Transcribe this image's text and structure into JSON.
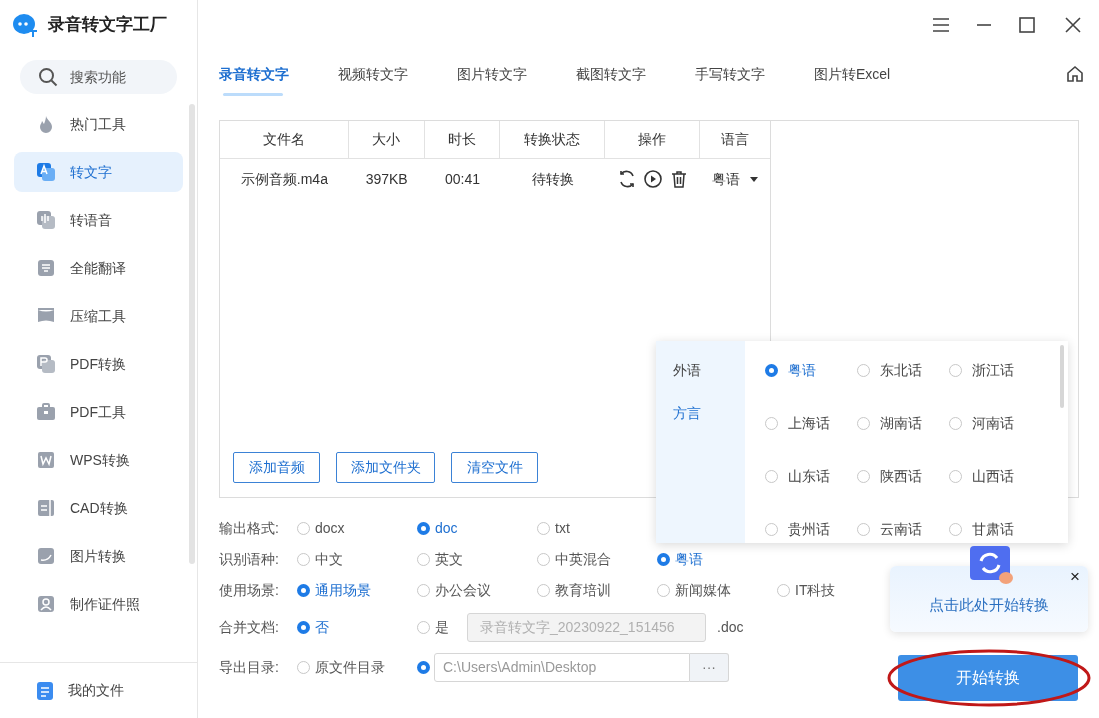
{
  "app": {
    "title": "录音转文字工厂"
  },
  "search": {
    "placeholder": "搜索功能"
  },
  "sidebar": {
    "items": [
      {
        "label": "热门工具",
        "selected": false
      },
      {
        "label": "转文字",
        "selected": true
      },
      {
        "label": "转语音",
        "selected": false
      },
      {
        "label": "全能翻译",
        "selected": false
      },
      {
        "label": "压缩工具",
        "selected": false
      },
      {
        "label": "PDF转换",
        "selected": false
      },
      {
        "label": "PDF工具",
        "selected": false
      },
      {
        "label": "WPS转换",
        "selected": false
      },
      {
        "label": "CAD转换",
        "selected": false
      },
      {
        "label": "图片转换",
        "selected": false
      },
      {
        "label": "制作证件照",
        "selected": false
      }
    ],
    "footer": "我的文件"
  },
  "tabs": [
    {
      "label": "录音转文字",
      "selected": true
    },
    {
      "label": "视频转文字",
      "selected": false
    },
    {
      "label": "图片转文字",
      "selected": false
    },
    {
      "label": "截图转文字",
      "selected": false
    },
    {
      "label": "手写转文字",
      "selected": false
    },
    {
      "label": "图片转Excel",
      "selected": false
    }
  ],
  "table": {
    "columns": [
      "文件名",
      "大小",
      "时长",
      "转换状态",
      "操作",
      "语言"
    ],
    "rows": [
      {
        "cells": [
          "示例音频.m4a",
          "397KB",
          "00:41",
          "待转换"
        ],
        "language": "粤语"
      }
    ]
  },
  "buttons": [
    "添加音频",
    "添加文件夹",
    "清空文件"
  ],
  "options": [
    {
      "kind": "radio",
      "label": "输出格式:",
      "choices": [
        {
          "label": "docx",
          "selected": false
        },
        {
          "label": "doc",
          "selected": true
        },
        {
          "label": "txt",
          "selected": false
        }
      ]
    },
    {
      "kind": "radio",
      "label": "识别语种:",
      "choices": [
        {
          "label": "中文",
          "selected": false
        },
        {
          "label": "英文",
          "selected": false
        },
        {
          "label": "中英混合",
          "selected": false
        },
        {
          "label": "粤语",
          "selected": true
        }
      ]
    },
    {
      "kind": "radio",
      "label": "使用场景:",
      "choices": [
        {
          "label": "通用场景",
          "selected": true
        },
        {
          "label": "办公会议",
          "selected": false
        },
        {
          "label": "教育培训",
          "selected": false
        },
        {
          "label": "新闻媒体",
          "selected": false
        },
        {
          "label": "IT科技",
          "selected": false
        }
      ]
    },
    {
      "kind": "merge",
      "label": "合并文档:",
      "choices": [
        {
          "label": "否",
          "selected": true
        },
        {
          "label": "是",
          "selected": false
        }
      ],
      "field": "录音转文字_20230922_151456",
      "suffix": ".doc"
    },
    {
      "kind": "export",
      "label": "导出目录:",
      "choices": [
        {
          "label": "原文件目录",
          "selected": false
        },
        {
          "selected": true
        }
      ],
      "field": "C:\\Users\\Admin\\Desktop",
      "browse": "···"
    }
  ],
  "language_popup": {
    "categories": [
      {
        "label": "外语",
        "selected": false
      },
      {
        "label": "方言",
        "selected": true
      }
    ],
    "options": [
      {
        "label": "粤语",
        "selected": true
      },
      {
        "label": "东北话",
        "selected": false
      },
      {
        "label": "浙江话",
        "selected": false
      },
      {
        "label": "上海话",
        "selected": false
      },
      {
        "label": "湖南话",
        "selected": false
      },
      {
        "label": "河南话",
        "selected": false
      },
      {
        "label": "山东话",
        "selected": false
      },
      {
        "label": "陕西话",
        "selected": false
      },
      {
        "label": "山西话",
        "selected": false
      },
      {
        "label": "贵州话",
        "selected": false
      },
      {
        "label": "云南话",
        "selected": false
      },
      {
        "label": "甘肃话",
        "selected": false
      }
    ]
  },
  "tooltip": {
    "text": "点击此处开始转换",
    "close": "×"
  },
  "start_button": "开始转换"
}
